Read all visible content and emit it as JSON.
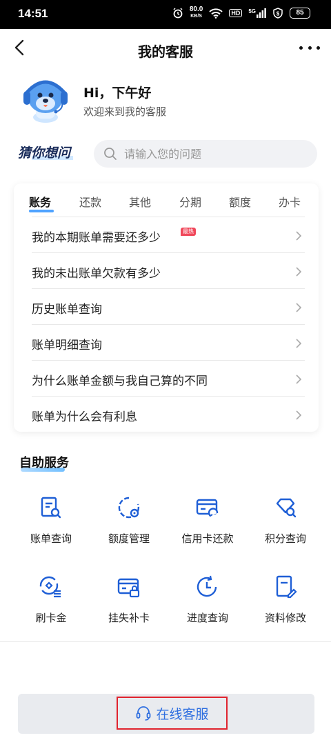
{
  "status_bar": {
    "time": "14:51",
    "net_speed": "80.0",
    "net_unit": "KB/S",
    "hd": "HD",
    "signal": "5G",
    "battery": "85"
  },
  "nav": {
    "title": "我的客服"
  },
  "greeting": {
    "title": "Hi，下午好",
    "subtitle": "欢迎来到我的客服"
  },
  "search": {
    "logo_text": "猜你想问",
    "placeholder": "请输入您的问题"
  },
  "faq": {
    "tabs": [
      "账务",
      "还款",
      "其他",
      "分期",
      "额度",
      "办卡"
    ],
    "active_tab": 0,
    "items": [
      {
        "question": "我的本期账单需要还多少",
        "badge": "最热"
      },
      {
        "question": "我的未出账单欠款有多少"
      },
      {
        "question": "历史账单查询"
      },
      {
        "question": "账单明细查询"
      },
      {
        "question": "为什么账单金额与我自己算的不同"
      },
      {
        "question": "账单为什么会有利息"
      }
    ]
  },
  "self_service": {
    "title": "自助服务",
    "items": [
      {
        "label": "账单查询",
        "icon": "bill-search-icon"
      },
      {
        "label": "额度管理",
        "icon": "quota-settings-icon"
      },
      {
        "label": "信用卡还款",
        "icon": "card-repay-icon"
      },
      {
        "label": "积分查询",
        "icon": "points-search-icon"
      },
      {
        "label": "刷卡金",
        "icon": "swipe-reward-icon"
      },
      {
        "label": "挂失补卡",
        "icon": "card-lock-icon"
      },
      {
        "label": "进度查询",
        "icon": "progress-clock-icon"
      },
      {
        "label": "资料修改",
        "icon": "edit-document-icon"
      }
    ]
  },
  "bottom": {
    "online_service_label": "在线客服"
  },
  "colors": {
    "accent_blue": "#2f6fe0",
    "icon_blue": "#1f5fd6",
    "hot_red": "#f0475a",
    "highlight_red": "#e0232e"
  }
}
